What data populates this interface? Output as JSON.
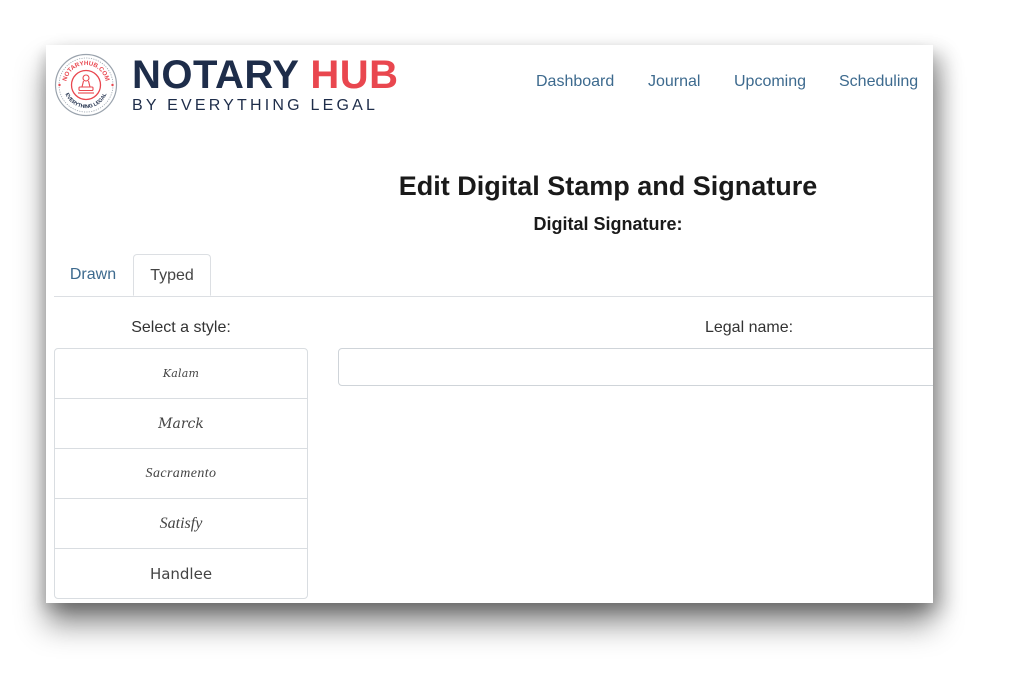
{
  "header": {
    "seal_top_text": "NOTARYHUB.COM",
    "seal_bottom_text": "EVERYTHING LEGAL",
    "brand_primary": "NOTARY",
    "brand_accent": "HUB",
    "brand_tagline": "BY EVERYTHING LEGAL",
    "colors": {
      "navy": "#1e2d4a",
      "red": "#e9474f",
      "link": "#3d6a8e"
    }
  },
  "nav": {
    "items": [
      "Dashboard",
      "Journal",
      "Upcoming",
      "Scheduling"
    ]
  },
  "page": {
    "title": "Edit Digital Stamp and Signature",
    "subtitle": "Digital Signature:"
  },
  "tabs": {
    "items": [
      "Drawn",
      "Typed"
    ],
    "active": "Typed"
  },
  "style_picker": {
    "label": "Select a style:",
    "options": [
      "Kalam",
      "Marck",
      "Sacramento",
      "Satisfy",
      "Handlee"
    ]
  },
  "legal_name": {
    "label": "Legal name:",
    "value": "",
    "placeholder": ""
  }
}
